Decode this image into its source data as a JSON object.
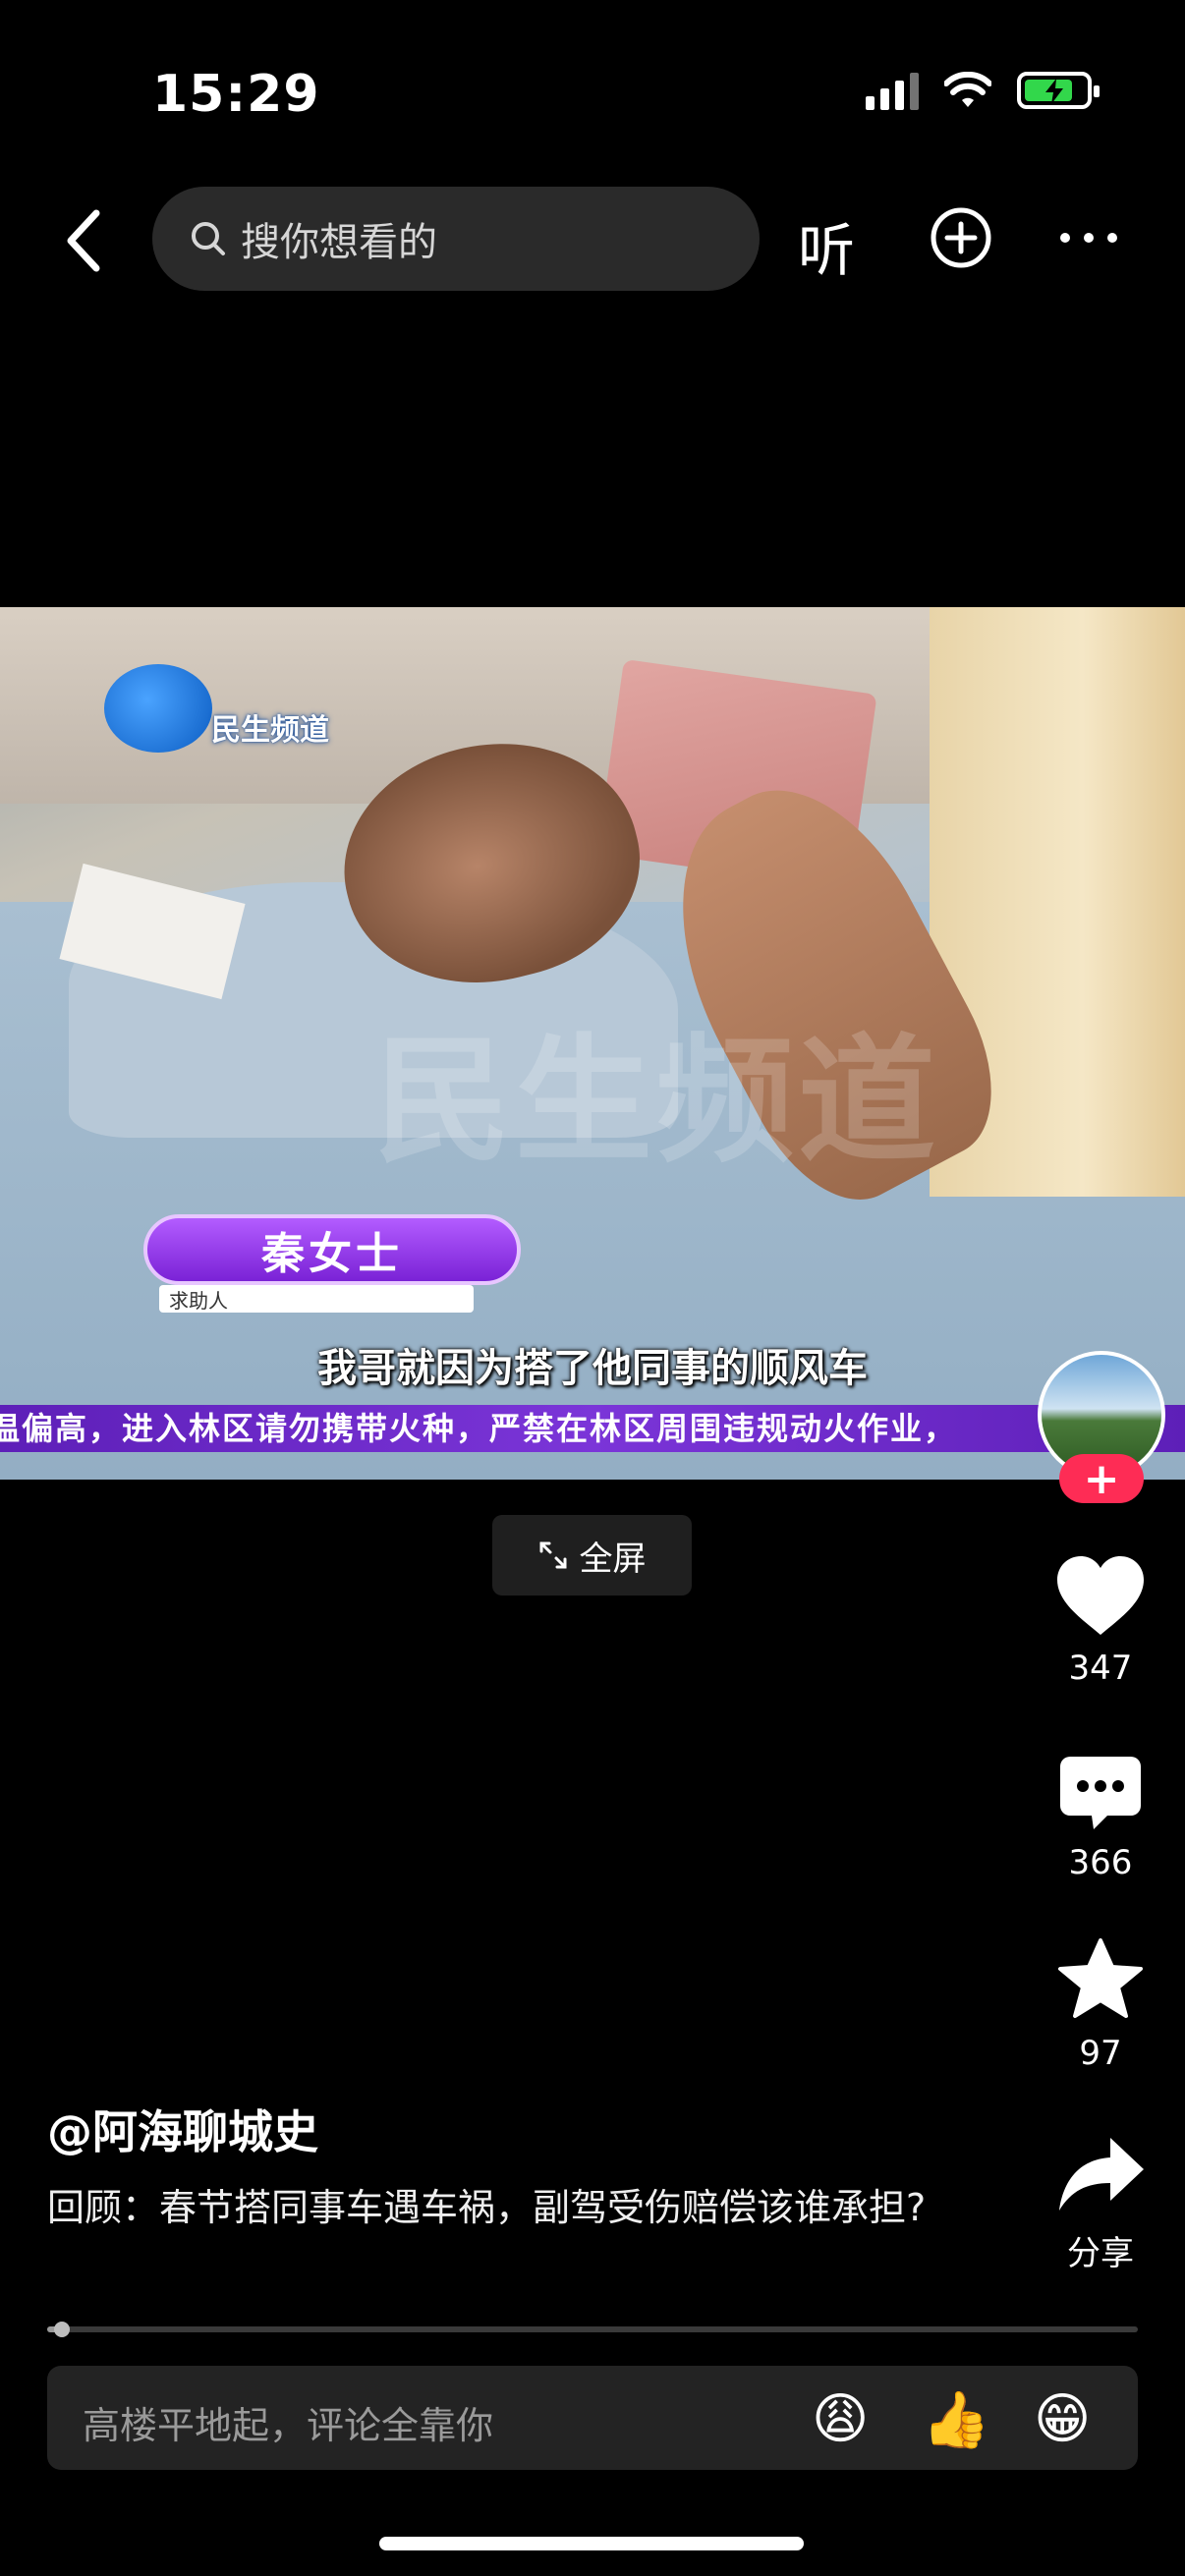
{
  "status_bar": {
    "time": "15:29"
  },
  "nav": {
    "search_placeholder": "搜你想看的",
    "listen_label": "听"
  },
  "video": {
    "channel_logo_text": "民生频道",
    "watermark_text": "民生频道",
    "person_name": "秦女士",
    "person_role": "求助人",
    "subtitle": "我哥就因为搭了他同事的顺风车",
    "ticker": "温偏高，进入林区请勿携带火种，严禁在林区周围违规动火作业，"
  },
  "fullscreen_label": "全屏",
  "actions": {
    "likes": "347",
    "comments": "366",
    "favorites": "97",
    "share_label": "分享"
  },
  "author": "@阿海聊城史",
  "caption": "回顾：春节搭同事车遇车祸，副驾受伤赔偿该谁承担?",
  "progress_fraction": 0.01,
  "comment_bar": {
    "placeholder": "高楼平地起，评论全靠你",
    "emojis": [
      "😩",
      "👍",
      "😁"
    ]
  },
  "colors": {
    "background": "#000000",
    "follow_accent": "#fe2c55",
    "nameplate_purple": "#8a2be2",
    "battery_green": "#32d74b"
  }
}
